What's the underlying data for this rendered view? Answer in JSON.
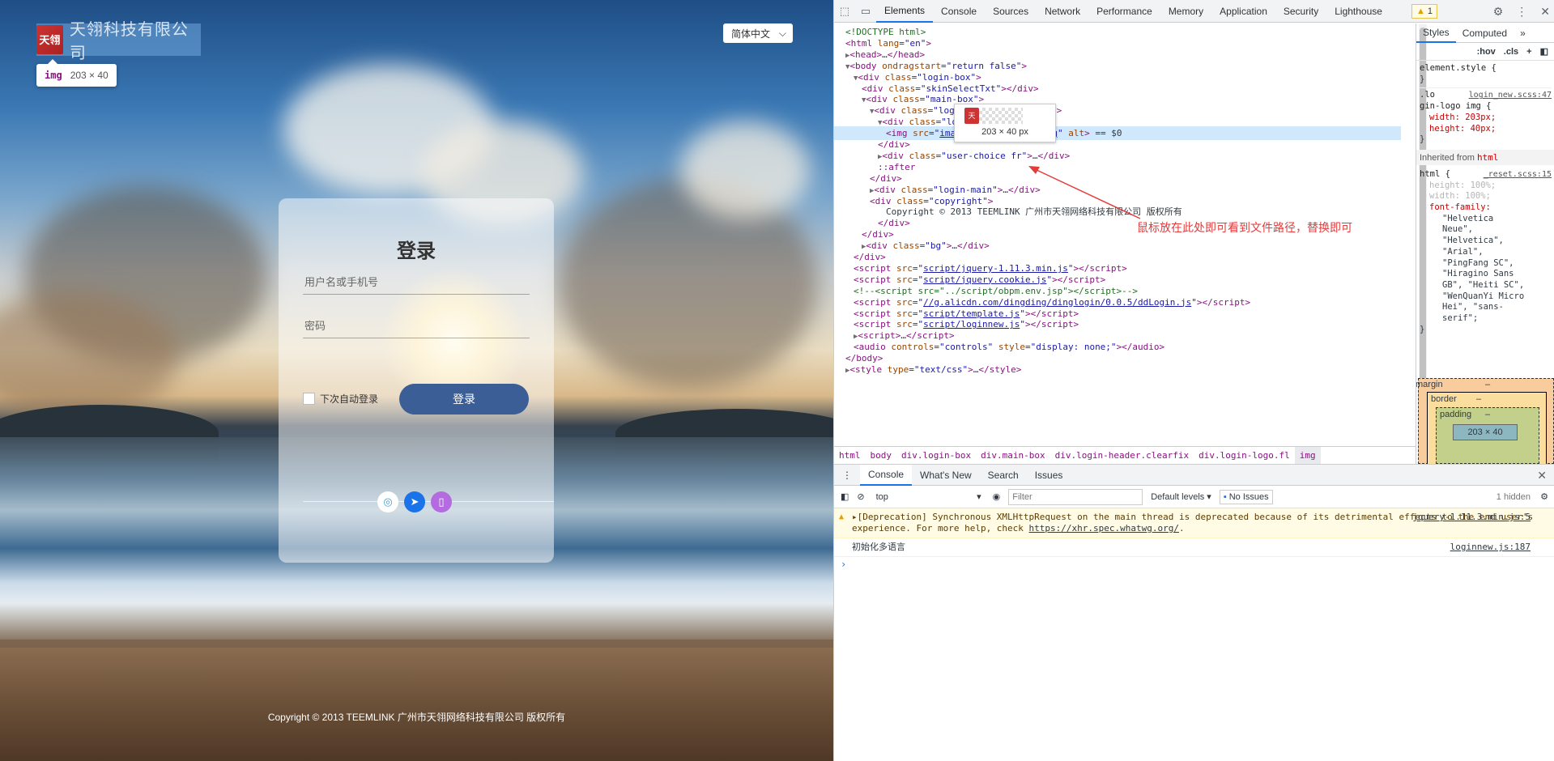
{
  "page": {
    "logo_text": "天翎科技有限公司",
    "logo_mark": "天翎",
    "inspect_tag": "img",
    "inspect_size": "203 × 40",
    "lang_value": "简体中文",
    "login": {
      "title": "登录",
      "username_placeholder": "用户名或手机号",
      "password_placeholder": "密码",
      "remember_label": "下次自动登录",
      "submit_label": "登录"
    },
    "sso_icons": [
      "wechat-icon",
      "dingtalk-icon",
      "mobile-icon"
    ],
    "copyright": "Copyright © 2013 TEEMLINK 广州市天翎网络科技有限公司 版权所有"
  },
  "devtools": {
    "tabs": [
      "Elements",
      "Console",
      "Sources",
      "Network",
      "Performance",
      "Memory",
      "Application",
      "Security",
      "Lighthouse"
    ],
    "active_tab": "Elements",
    "warning_count": "1",
    "dom_lines": [
      {
        "indent": 0,
        "html": "<span class='cmt'>&lt;!DOCTYPE html&gt;</span>"
      },
      {
        "indent": 0,
        "html": "<span class='tag'>&lt;html</span> <span class='attr'>lang</span>=<span class='aval'>\"en\"</span><span class='tag'>&gt;</span>"
      },
      {
        "indent": 0,
        "html": "<span class='tri'>▶</span><span class='tag'>&lt;head&gt;</span>…<span class='tag'>&lt;/head&gt;</span>"
      },
      {
        "indent": 0,
        "html": "<span class='tri'>▼</span><span class='tag'>&lt;body</span> <span class='attr'>ondragstart</span>=<span class='aval'>\"return false\"</span><span class='tag'>&gt;</span>"
      },
      {
        "indent": 1,
        "html": "<span class='tri'>▼</span><span class='tag'>&lt;div</span> <span class='attr'>class</span>=<span class='aval'>\"login-box\"</span><span class='tag'>&gt;</span>"
      },
      {
        "indent": 2,
        "html": "<span class='tag'>&lt;div</span> <span class='attr'>class</span>=<span class='aval'>\"skinSelectTxt\"</span><span class='tag'>&gt;&lt;/div&gt;</span>"
      },
      {
        "indent": 2,
        "html": "<span class='tri'>▼</span><span class='tag'>&lt;div</span> <span class='attr'>class</span>=<span class='aval'>\"main-box\"</span><span class='tag'>&gt;</span>"
      },
      {
        "indent": 3,
        "html": "<span class='tri'>▼</span><span class='tag'>&lt;div</span> <span class='attr'>class</span>=<span class='aval'>\"login-header clearfix\"</span><span class='tag'>&gt;</span>"
      },
      {
        "indent": 4,
        "html": "<span class='tri'>▼</span><span class='tag'>&lt;div</span> <span class='attr'>class</span>=<span class='aval'>\"login-logo fl\"</span><span class='tag'>&gt;</span>"
      },
      {
        "indent": 5,
        "html": "<span class='tag'>&lt;img</span> <span class='attr'>src</span>=<span class='aval'>\"<span class='link'>images/login_logoa.png</span>\"</span> <span class='attr'>alt</span><span class='tag'>&gt;</span> <span class='txt'>== $0</span>",
        "selected": true
      },
      {
        "indent": 4,
        "html": "<span class='tag'>&lt;/div&gt;</span>"
      },
      {
        "indent": 4,
        "html": "<span class='tri'>▶</span><span class='tag'>&lt;div</span> <span class='attr'>class</span>=<span class='aval'>\"user-choice fr\"</span><span class='tag'>&gt;</span>…<span class='tag'>&lt;/div&gt;</span>"
      },
      {
        "indent": 4,
        "html": "<span class='tag'>::after</span>"
      },
      {
        "indent": 3,
        "html": "<span class='tag'>&lt;/div&gt;</span>"
      },
      {
        "indent": 3,
        "html": "<span class='tri'>▶</span><span class='tag'>&lt;div</span> <span class='attr'>class</span>=<span class='aval'>\"login-main\"</span><span class='tag'>&gt;</span>…<span class='tag'>&lt;/div&gt;</span>"
      },
      {
        "indent": 3,
        "html": "<span class='tag'>&lt;div</span> <span class='attr'>class</span>=<span class='aval'>\"copyright\"</span><span class='tag'>&gt;</span>"
      },
      {
        "indent": 5,
        "html": "<span class='txt'>Copyright © 2013 TEEMLINK 广州市天翎网络科技有限公司 版权所有</span>"
      },
      {
        "indent": 4,
        "html": "<span class='tag'>&lt;/div&gt;</span>"
      },
      {
        "indent": 2,
        "html": "<span class='tag'>&lt;/div&gt;</span>"
      },
      {
        "indent": 2,
        "html": "<span class='tri'>▶</span><span class='tag'>&lt;div</span> <span class='attr'>class</span>=<span class='aval'>\"bg\"</span><span class='tag'>&gt;</span>…<span class='tag'>&lt;/div&gt;</span>"
      },
      {
        "indent": 1,
        "html": "<span class='tag'>&lt;/div&gt;</span>"
      },
      {
        "indent": 1,
        "html": "<span class='tag'>&lt;script</span> <span class='attr'>src</span>=<span class='aval'>\"<span class='link'>script/jquery-1.11.3.min.js</span>\"</span><span class='tag'>&gt;&lt;/script&gt;</span>"
      },
      {
        "indent": 1,
        "html": "<span class='tag'>&lt;script</span> <span class='attr'>src</span>=<span class='aval'>\"<span class='link'>script/jquery.cookie.js</span>\"</span><span class='tag'>&gt;&lt;/script&gt;</span>"
      },
      {
        "indent": 1,
        "html": "<span class='cmt'>&lt;!--&lt;script src=\"../script/obpm.env.jsp\"&gt;&lt;/script&gt;--&gt;</span>"
      },
      {
        "indent": 1,
        "html": "<span class='tag'>&lt;script</span> <span class='attr'>src</span>=<span class='aval'>\"<span class='link'>//g.alicdn.com/dingding/dinglogin/0.0.5/ddLogin.js</span>\"</span><span class='tag'>&gt;&lt;/script&gt;</span>"
      },
      {
        "indent": 1,
        "html": "<span class='tag'>&lt;script</span> <span class='attr'>src</span>=<span class='aval'>\"<span class='link'>script/template.js</span>\"</span><span class='tag'>&gt;&lt;/script&gt;</span>"
      },
      {
        "indent": 1,
        "html": "<span class='tag'>&lt;script</span> <span class='attr'>src</span>=<span class='aval'>\"<span class='link'>script/loginnew.js</span>\"</span><span class='tag'>&gt;&lt;/script&gt;</span>"
      },
      {
        "indent": 1,
        "html": "<span class='tri'>▶</span><span class='tag'>&lt;script&gt;</span>…<span class='tag'>&lt;/script&gt;</span>"
      },
      {
        "indent": 1,
        "html": "<span class='tag'>&lt;audio</span> <span class='attr'>controls</span>=<span class='aval'>\"controls\"</span> <span class='attr'>style</span>=<span class='aval'>\"display: none;\"</span><span class='tag'>&gt;&lt;/audio&gt;</span>"
      },
      {
        "indent": 0,
        "html": "<span class='tag'>&lt;/body&gt;</span>"
      },
      {
        "indent": 0,
        "html": "<span class='tri'>▶</span><span class='tag'>&lt;style</span> <span class='attr'>type</span>=<span class='aval'>\"text/css\"</span><span class='tag'>&gt;</span>…<span class='tag'>&lt;/style&gt;</span>"
      }
    ],
    "img_preview_size": "203 × 40 px",
    "annotation": "鼠标放在此处即可看到文件路径，替换即可",
    "breadcrumbs": [
      "html",
      "body",
      "div.login-box",
      "div.main-box",
      "div.login-header.clearfix",
      "div.login-logo.fl",
      "img"
    ],
    "styles": {
      "tabs": [
        "Styles",
        "Computed"
      ],
      "filter_hov": ":hov",
      "filter_cls": ".cls",
      "element_style": "element.style {",
      "rule_selector_1": ".lo",
      "rule_selector_2": "gin-logo img {",
      "rule_source": "login_new.scss:47",
      "rule_props": [
        "width: 203px;",
        "height: 40px;"
      ],
      "inherited_label": "Inherited from",
      "inherited_tag": "html",
      "html_rule_source": "_reset.scss:15",
      "html_props": [
        "height: 100%;",
        "width: 100%;"
      ],
      "font_family_label": "font-family:",
      "font_family_values": [
        "\"Helvetica",
        "Neue\",",
        "\"Helvetica\",",
        "\"Arial\",",
        "\"PingFang SC\",",
        "\"Hiragino Sans",
        "GB\", \"Heiti SC\",",
        "\"WenQuanYi Micro",
        "Hei\", \"sans-",
        "serif\";"
      ],
      "box_margin": "margin",
      "box_border": "border",
      "box_padding": "padding",
      "box_content": "203 × 40",
      "box_dash": "–"
    },
    "drawer": {
      "tabs": [
        "Console",
        "What's New",
        "Search",
        "Issues"
      ],
      "context": "top",
      "filter_placeholder": "Filter",
      "levels": "Default levels",
      "no_issues": "No Issues",
      "hidden": "1 hidden",
      "messages": [
        {
          "type": "warn",
          "text": "[Deprecation] Synchronous XMLHttpRequest on the main thread is deprecated because of its detrimental effects to the end user's experience. For more help, check ",
          "link": "https://xhr.spec.whatwg.org/",
          "tail": ".",
          "source": "jquery-1.11.3.min.js:5"
        },
        {
          "type": "log",
          "text": "初始化多语言",
          "source": "loginnew.js:187"
        }
      ],
      "prompt": "›"
    }
  }
}
